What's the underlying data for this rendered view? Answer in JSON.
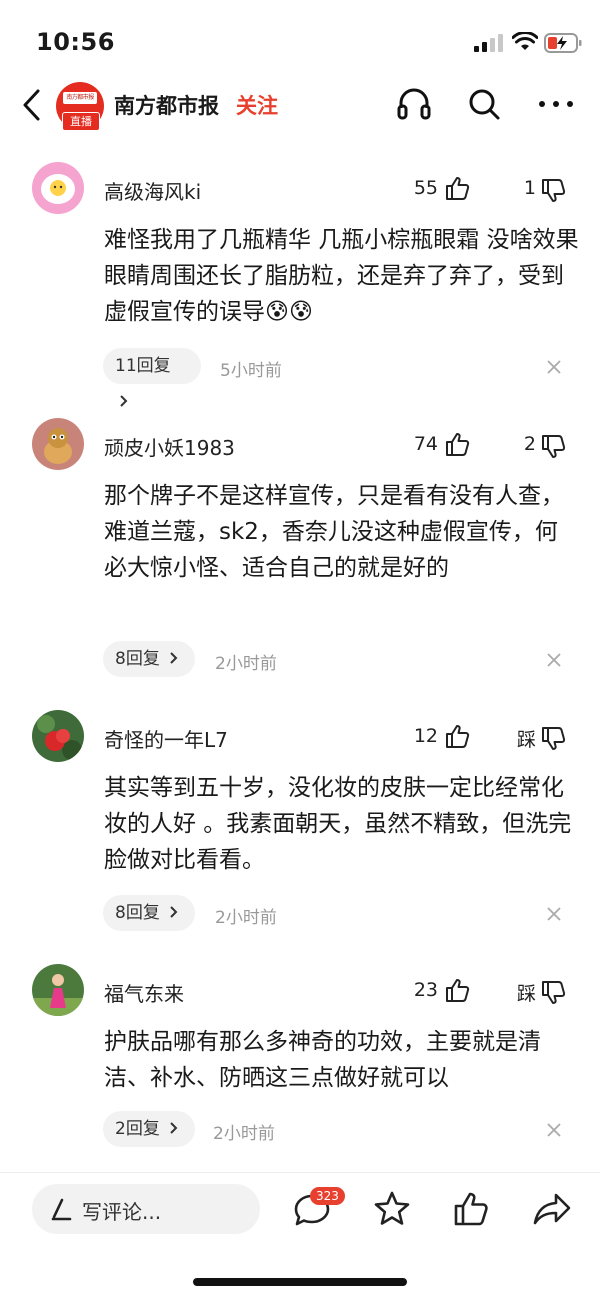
{
  "status_bar": {
    "time": "10:56"
  },
  "header": {
    "source_name": "南方都市报",
    "follow_label": "关注",
    "live_label": "直播",
    "logo_text": "南方都市报"
  },
  "comments": [
    {
      "user": "高级海风ki",
      "likes": "55",
      "dislikes": "1",
      "text": "难怪我用了几瓶精华 几瓶小棕瓶眼霜 没啥效果 眼睛周围还长了脂肪粒，还是弃了弃了，受到虚假宣传的误导😰😰",
      "replies": "11回复",
      "time": "5小时前"
    },
    {
      "user": "顽皮小妖1983",
      "likes": "74",
      "dislikes": "2",
      "text": "那个牌子不是这样宣传，只是看有没有人查，难道兰蔻，sk2，香奈儿没这种虚假宣传，何必大惊小怪、适合自己的就是好的",
      "replies": "8回复",
      "time": "2小时前"
    },
    {
      "user": "奇怪的一年L7",
      "likes": "12",
      "dislikes": "踩",
      "text": "其实等到五十岁，没化妆的皮肤一定比经常化妆的人好 。我素面朝天，虽然不精致，但洗完脸做对比看看。",
      "replies": "8回复",
      "time": "2小时前"
    },
    {
      "user": "福气东来",
      "likes": "23",
      "dislikes": "踩",
      "text": "护肤品哪有那么多神奇的功效，主要就是清洁、补水、防晒这三点做好就可以",
      "replies": "2回复",
      "time": "2小时前"
    }
  ],
  "bottom_bar": {
    "write_placeholder": "写评论...",
    "comment_count": "323"
  },
  "colors": {
    "accent": "#e8402e",
    "brand_red": "#e52c20",
    "pill_bg": "#f2f2f2",
    "muted": "#999999"
  },
  "icons": [
    "back-arrow-icon",
    "headphone-icon",
    "search-icon",
    "more-icon",
    "thumbs-up-icon",
    "thumbs-down-icon",
    "chevron-right-icon",
    "close-icon",
    "pen-icon",
    "comment-bubble-icon",
    "star-icon",
    "share-icon"
  ]
}
